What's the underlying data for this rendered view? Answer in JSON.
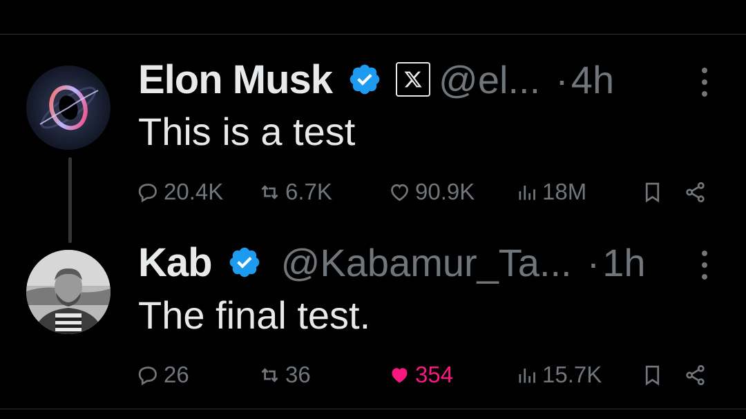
{
  "tweets": [
    {
      "name": "Elon Musk",
      "verified": true,
      "affiliate": "X",
      "handle": "@el...",
      "separator": "·",
      "time": "4h",
      "text": "This is a test",
      "replies": "20.4K",
      "reposts": "6.7K",
      "likes": "90.9K",
      "views": "18M",
      "liked": false
    },
    {
      "name": "Kab",
      "verified": true,
      "handle": "@Kabamur_Ta...",
      "separator": "·",
      "time": "1h",
      "text": "The final test.",
      "replies": "26",
      "reposts": "36",
      "likes": "354",
      "views": "15.7K",
      "liked": true
    }
  ],
  "colors": {
    "background": "#000000",
    "text": "#e7e9ea",
    "muted": "#71767b",
    "verified": "#1d9bf0",
    "like": "#f91880"
  }
}
